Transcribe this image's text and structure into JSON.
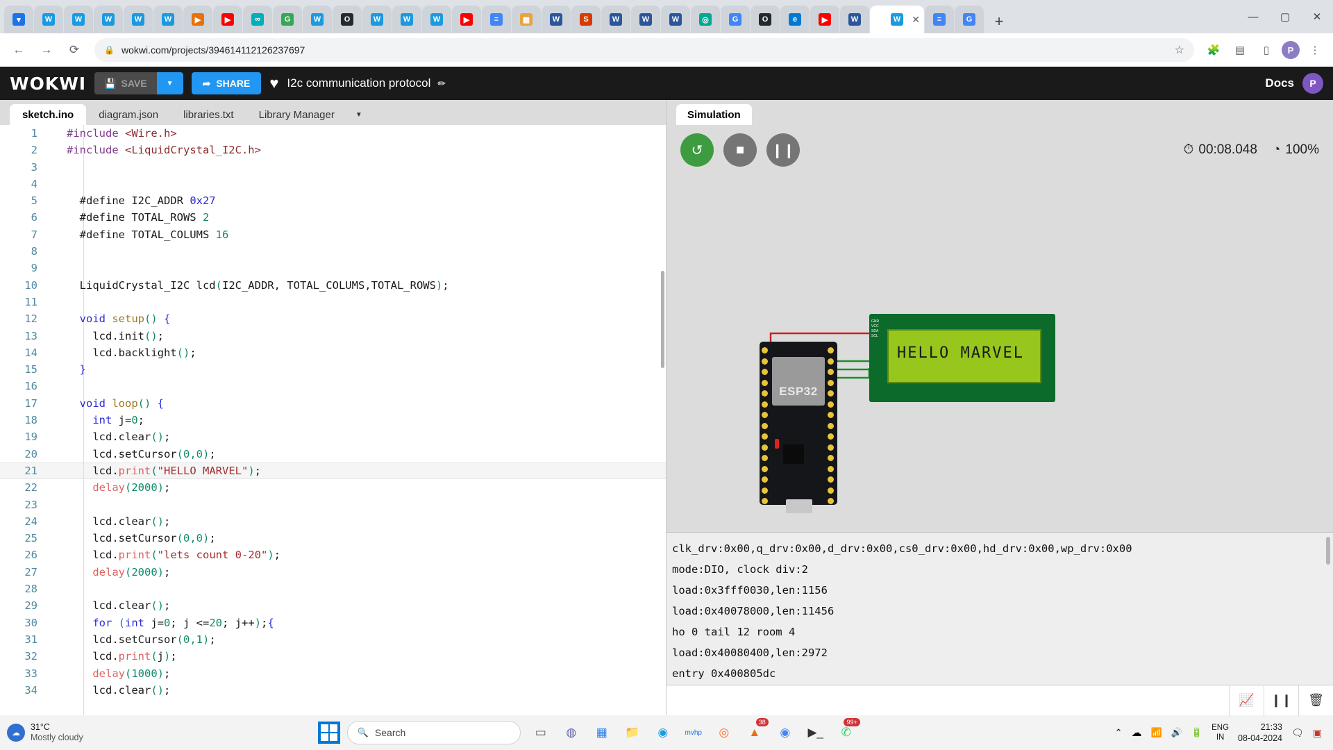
{
  "browser": {
    "tabs": [
      {
        "glyph": "▾",
        "color": "#1a73e8"
      },
      {
        "glyph": "W",
        "color": "#1a9ae0"
      },
      {
        "glyph": "W",
        "color": "#1a9ae0"
      },
      {
        "glyph": "W",
        "color": "#1a9ae0"
      },
      {
        "glyph": "W",
        "color": "#1a9ae0"
      },
      {
        "glyph": "W",
        "color": "#1a9ae0"
      },
      {
        "glyph": "▶",
        "color": "#e8710a"
      },
      {
        "glyph": "▶",
        "color": "#ff0000"
      },
      {
        "glyph": "∞",
        "color": "#00b0b9"
      },
      {
        "glyph": "G",
        "color": "#34a853"
      },
      {
        "glyph": "W",
        "color": "#1a9ae0"
      },
      {
        "glyph": "O",
        "color": "#24292e"
      },
      {
        "glyph": "W",
        "color": "#1a9ae0"
      },
      {
        "glyph": "W",
        "color": "#1a9ae0"
      },
      {
        "glyph": "W",
        "color": "#1a9ae0"
      },
      {
        "glyph": "▶",
        "color": "#ff0000"
      },
      {
        "glyph": "≡",
        "color": "#4285f4"
      },
      {
        "glyph": "▦",
        "color": "#e8a33d"
      },
      {
        "glyph": "W",
        "color": "#2b579a"
      },
      {
        "glyph": "S",
        "color": "#d83b01"
      },
      {
        "glyph": "W",
        "color": "#2b579a"
      },
      {
        "glyph": "W",
        "color": "#2b579a"
      },
      {
        "glyph": "W",
        "color": "#2b579a"
      },
      {
        "glyph": "◎",
        "color": "#00a98f"
      },
      {
        "glyph": "G",
        "color": "#4285f4"
      },
      {
        "glyph": "O",
        "color": "#24292e"
      },
      {
        "glyph": "e",
        "color": "#0078d4"
      },
      {
        "glyph": "▶",
        "color": "#ff0000"
      },
      {
        "glyph": "W",
        "color": "#2b579a"
      }
    ],
    "active_tab": {
      "glyph": "W",
      "color": "#1a9ae0",
      "close": "✕"
    },
    "trailing_tabs": [
      {
        "glyph": "≡",
        "color": "#4285f4"
      },
      {
        "glyph": "G",
        "color": "#4285f4"
      }
    ],
    "new_tab_label": "+",
    "window_controls": {
      "minimize": "—",
      "maximize": "▢",
      "close": "✕"
    },
    "nav": {
      "back": "←",
      "forward": "→",
      "reload": "⟳"
    },
    "omnibox": {
      "site_icon": "🔒",
      "url": "wokwi.com/projects/394614112126237697",
      "star": "☆"
    },
    "toolbar_icons": {
      "extensions": "🧩",
      "reading_list": "▤",
      "side_panel": "▯",
      "menu": "⋮"
    },
    "profile_initial": "P"
  },
  "wokwi": {
    "logo": "WOKWI",
    "save_label": "SAVE",
    "save_caret": "▼",
    "share_label": "SHARE",
    "share_icon": "➦",
    "favorite_icon": "♥",
    "project_title": "I2c communication protocol",
    "edit_icon": "✏",
    "docs_label": "Docs",
    "avatar_initial": "P",
    "editor_tabs": [
      {
        "label": "sketch.ino",
        "active": true
      },
      {
        "label": "diagram.json",
        "active": false
      },
      {
        "label": "libraries.txt",
        "active": false
      },
      {
        "label": "Library Manager",
        "active": false
      }
    ],
    "editor_tabs_caret": "▼",
    "code_lines": [
      {
        "n": 1,
        "tokens": [
          {
            "t": "#include ",
            "c": "pre"
          },
          {
            "t": "<Wire.h>",
            "c": "inc"
          }
        ]
      },
      {
        "n": 2,
        "tokens": [
          {
            "t": "#include ",
            "c": "pre"
          },
          {
            "t": "<LiquidCrystal_I2C.h>",
            "c": "inc"
          }
        ]
      },
      {
        "n": 3,
        "tokens": []
      },
      {
        "n": 4,
        "tokens": []
      },
      {
        "n": 5,
        "tokens": [
          {
            "t": "  #define I2C_ADDR ",
            "c": "plain"
          },
          {
            "t": "0x27",
            "c": "kw"
          }
        ]
      },
      {
        "n": 6,
        "tokens": [
          {
            "t": "  #define TOTAL_ROWS ",
            "c": "plain"
          },
          {
            "t": "2",
            "c": "num"
          }
        ]
      },
      {
        "n": 7,
        "tokens": [
          {
            "t": "  #define TOTAL_COLUMS ",
            "c": "plain"
          },
          {
            "t": "16",
            "c": "num"
          }
        ]
      },
      {
        "n": 8,
        "tokens": []
      },
      {
        "n": 9,
        "tokens": []
      },
      {
        "n": 10,
        "tokens": [
          {
            "t": "  LiquidCrystal_I2C lcd",
            "c": "plain"
          },
          {
            "t": "(",
            "c": "par"
          },
          {
            "t": "I2C_ADDR, TOTAL_COLUMS,TOTAL_ROWS",
            "c": "plain"
          },
          {
            "t": ")",
            "c": "par"
          },
          {
            "t": ";",
            "c": "plain"
          }
        ]
      },
      {
        "n": 11,
        "tokens": []
      },
      {
        "n": 12,
        "tokens": [
          {
            "t": "  void ",
            "c": "kw"
          },
          {
            "t": "setup",
            "c": "fn"
          },
          {
            "t": "()",
            "c": "par"
          },
          {
            "t": " ",
            "c": "plain"
          },
          {
            "t": "{",
            "c": "kw"
          }
        ]
      },
      {
        "n": 13,
        "tokens": [
          {
            "t": "    lcd.init",
            "c": "plain"
          },
          {
            "t": "()",
            "c": "par"
          },
          {
            "t": ";",
            "c": "plain"
          }
        ]
      },
      {
        "n": 14,
        "tokens": [
          {
            "t": "    lcd.backlight",
            "c": "plain"
          },
          {
            "t": "()",
            "c": "par"
          },
          {
            "t": ";",
            "c": "plain"
          }
        ]
      },
      {
        "n": 15,
        "tokens": [
          {
            "t": "  }",
            "c": "kw"
          }
        ]
      },
      {
        "n": 16,
        "tokens": []
      },
      {
        "n": 17,
        "tokens": [
          {
            "t": "  void ",
            "c": "kw"
          },
          {
            "t": "loop",
            "c": "fn"
          },
          {
            "t": "()",
            "c": "par"
          },
          {
            "t": " ",
            "c": "plain"
          },
          {
            "t": "{",
            "c": "kw"
          }
        ]
      },
      {
        "n": 18,
        "tokens": [
          {
            "t": "    int ",
            "c": "kw"
          },
          {
            "t": "j=",
            "c": "plain"
          },
          {
            "t": "0",
            "c": "num"
          },
          {
            "t": ";",
            "c": "plain"
          }
        ]
      },
      {
        "n": 19,
        "tokens": [
          {
            "t": "    lcd.clear",
            "c": "plain"
          },
          {
            "t": "()",
            "c": "par"
          },
          {
            "t": ";",
            "c": "plain"
          }
        ]
      },
      {
        "n": 20,
        "tokens": [
          {
            "t": "    lcd.setCursor",
            "c": "plain"
          },
          {
            "t": "(",
            "c": "par"
          },
          {
            "t": "0,0",
            "c": "num"
          },
          {
            "t": ")",
            "c": "par"
          },
          {
            "t": ";",
            "c": "plain"
          }
        ]
      },
      {
        "n": 21,
        "hl": true,
        "tokens": [
          {
            "t": "    lcd.",
            "c": "plain"
          },
          {
            "t": "print",
            "c": "call"
          },
          {
            "t": "(",
            "c": "par"
          },
          {
            "t": "\"HELLO MARVEL\"",
            "c": "str"
          },
          {
            "t": ")",
            "c": "par"
          },
          {
            "t": ";",
            "c": "plain"
          }
        ]
      },
      {
        "n": 22,
        "tokens": [
          {
            "t": "    ",
            "c": "plain"
          },
          {
            "t": "delay",
            "c": "call"
          },
          {
            "t": "(",
            "c": "par"
          },
          {
            "t": "2000",
            "c": "num"
          },
          {
            "t": ")",
            "c": "par"
          },
          {
            "t": ";",
            "c": "plain"
          }
        ]
      },
      {
        "n": 23,
        "tokens": []
      },
      {
        "n": 24,
        "tokens": [
          {
            "t": "    lcd.clear",
            "c": "plain"
          },
          {
            "t": "()",
            "c": "par"
          },
          {
            "t": ";",
            "c": "plain"
          }
        ]
      },
      {
        "n": 25,
        "tokens": [
          {
            "t": "    lcd.setCursor",
            "c": "plain"
          },
          {
            "t": "(",
            "c": "par"
          },
          {
            "t": "0,0",
            "c": "num"
          },
          {
            "t": ")",
            "c": "par"
          },
          {
            "t": ";",
            "c": "plain"
          }
        ]
      },
      {
        "n": 26,
        "tokens": [
          {
            "t": "    lcd.",
            "c": "plain"
          },
          {
            "t": "print",
            "c": "call"
          },
          {
            "t": "(",
            "c": "par"
          },
          {
            "t": "\"lets count 0-20\"",
            "c": "str"
          },
          {
            "t": ")",
            "c": "par"
          },
          {
            "t": ";",
            "c": "plain"
          }
        ]
      },
      {
        "n": 27,
        "tokens": [
          {
            "t": "    ",
            "c": "plain"
          },
          {
            "t": "delay",
            "c": "call"
          },
          {
            "t": "(",
            "c": "par"
          },
          {
            "t": "2000",
            "c": "num"
          },
          {
            "t": ")",
            "c": "par"
          },
          {
            "t": ";",
            "c": "plain"
          }
        ]
      },
      {
        "n": 28,
        "tokens": []
      },
      {
        "n": 29,
        "tokens": [
          {
            "t": "    lcd.clear",
            "c": "plain"
          },
          {
            "t": "()",
            "c": "par"
          },
          {
            "t": ";",
            "c": "plain"
          }
        ]
      },
      {
        "n": 30,
        "tokens": [
          {
            "t": "    for ",
            "c": "kw"
          },
          {
            "t": "(",
            "c": "par"
          },
          {
            "t": "int ",
            "c": "kw"
          },
          {
            "t": "j=",
            "c": "plain"
          },
          {
            "t": "0",
            "c": "num"
          },
          {
            "t": "; j <=",
            "c": "plain"
          },
          {
            "t": "20",
            "c": "num"
          },
          {
            "t": "; j++",
            "c": "plain"
          },
          {
            "t": ")",
            "c": "par"
          },
          {
            "t": ";",
            "c": "plain"
          },
          {
            "t": "{",
            "c": "kw"
          }
        ]
      },
      {
        "n": 31,
        "tokens": [
          {
            "t": "    lcd.setCursor",
            "c": "plain"
          },
          {
            "t": "(",
            "c": "par"
          },
          {
            "t": "0,1",
            "c": "num"
          },
          {
            "t": ")",
            "c": "par"
          },
          {
            "t": ";",
            "c": "plain"
          }
        ]
      },
      {
        "n": 32,
        "tokens": [
          {
            "t": "    lcd.",
            "c": "plain"
          },
          {
            "t": "print",
            "c": "call"
          },
          {
            "t": "(",
            "c": "par"
          },
          {
            "t": "j",
            "c": "plain"
          },
          {
            "t": ")",
            "c": "par"
          },
          {
            "t": ";",
            "c": "plain"
          }
        ]
      },
      {
        "n": 33,
        "tokens": [
          {
            "t": "    ",
            "c": "plain"
          },
          {
            "t": "delay",
            "c": "call"
          },
          {
            "t": "(",
            "c": "par"
          },
          {
            "t": "1000",
            "c": "num"
          },
          {
            "t": ")",
            "c": "par"
          },
          {
            "t": ";",
            "c": "plain"
          }
        ]
      },
      {
        "n": 34,
        "tokens": [
          {
            "t": "    lcd.clear",
            "c": "plain"
          },
          {
            "t": "()",
            "c": "par"
          },
          {
            "t": ";",
            "c": "plain"
          }
        ]
      }
    ],
    "sim_tab_label": "Simulation",
    "controls": {
      "restart": "↺",
      "stop": "■",
      "pause": "❙❙"
    },
    "timer_icon": "⏱",
    "timer": "00:08.048",
    "speed_icon": "◔",
    "speed": "100%",
    "board_label": "ESP32",
    "lcd_text": "HELLO MARVEL",
    "lcd_pin_labels": [
      "GND",
      "VCC",
      "SDA",
      "SCL"
    ],
    "serial_lines": [
      "clk_drv:0x00,q_drv:0x00,d_drv:0x00,cs0_drv:0x00,hd_drv:0x00,wp_drv:0x00",
      "mode:DIO, clock div:2",
      "load:0x3fff0030,len:1156",
      "load:0x40078000,len:11456",
      "ho 0 tail 12 room 4",
      "load:0x40080400,len:2972",
      "entry 0x400805dc"
    ],
    "serial_buttons": {
      "chart": "📈",
      "pause": "❙❙",
      "clear": "🗑"
    }
  },
  "taskbar": {
    "weather": {
      "temp": "31°C",
      "desc": "Mostly cloudy",
      "icon": "☁"
    },
    "start_label": "Start",
    "search_icon": "🔍",
    "search_placeholder": "Search",
    "icons": [
      {
        "name": "task-view",
        "glyph": "▭",
        "color": "#5a5a5a",
        "badge": null
      },
      {
        "name": "teams",
        "glyph": "◍",
        "color": "#6264a7",
        "badge": null
      },
      {
        "name": "store",
        "glyph": "▦",
        "color": "#2b7de9",
        "badge": null
      },
      {
        "name": "file-explorer",
        "glyph": "📁",
        "color": "#e9b94a",
        "badge": null
      },
      {
        "name": "edge",
        "glyph": "◉",
        "color": "#1b9de2",
        "badge": null
      },
      {
        "name": "myhp",
        "glyph": "mvhp",
        "color": "#1a73e8",
        "badge": null
      },
      {
        "name": "firefox",
        "glyph": "◎",
        "color": "#ff7139",
        "badge": null
      },
      {
        "name": "vlc",
        "glyph": "▲",
        "color": "#e8701a",
        "badge": "38"
      },
      {
        "name": "chrome",
        "glyph": "◉",
        "color": "#4285f4",
        "badge": null
      },
      {
        "name": "terminal",
        "glyph": "▶_",
        "color": "#333333",
        "badge": null
      },
      {
        "name": "whatsapp",
        "glyph": "✆",
        "color": "#25d366",
        "badge": "99+"
      }
    ],
    "tray": {
      "chevron": "⌃",
      "cloud": "☁",
      "wifi": "📶",
      "volume": "🔊",
      "battery": "🔋"
    },
    "language": {
      "line1": "ENG",
      "line2": "IN"
    },
    "clock": {
      "time": "21:33",
      "date": "08-04-2024"
    },
    "notification_icon": "🗨",
    "action_icon": "▣"
  }
}
